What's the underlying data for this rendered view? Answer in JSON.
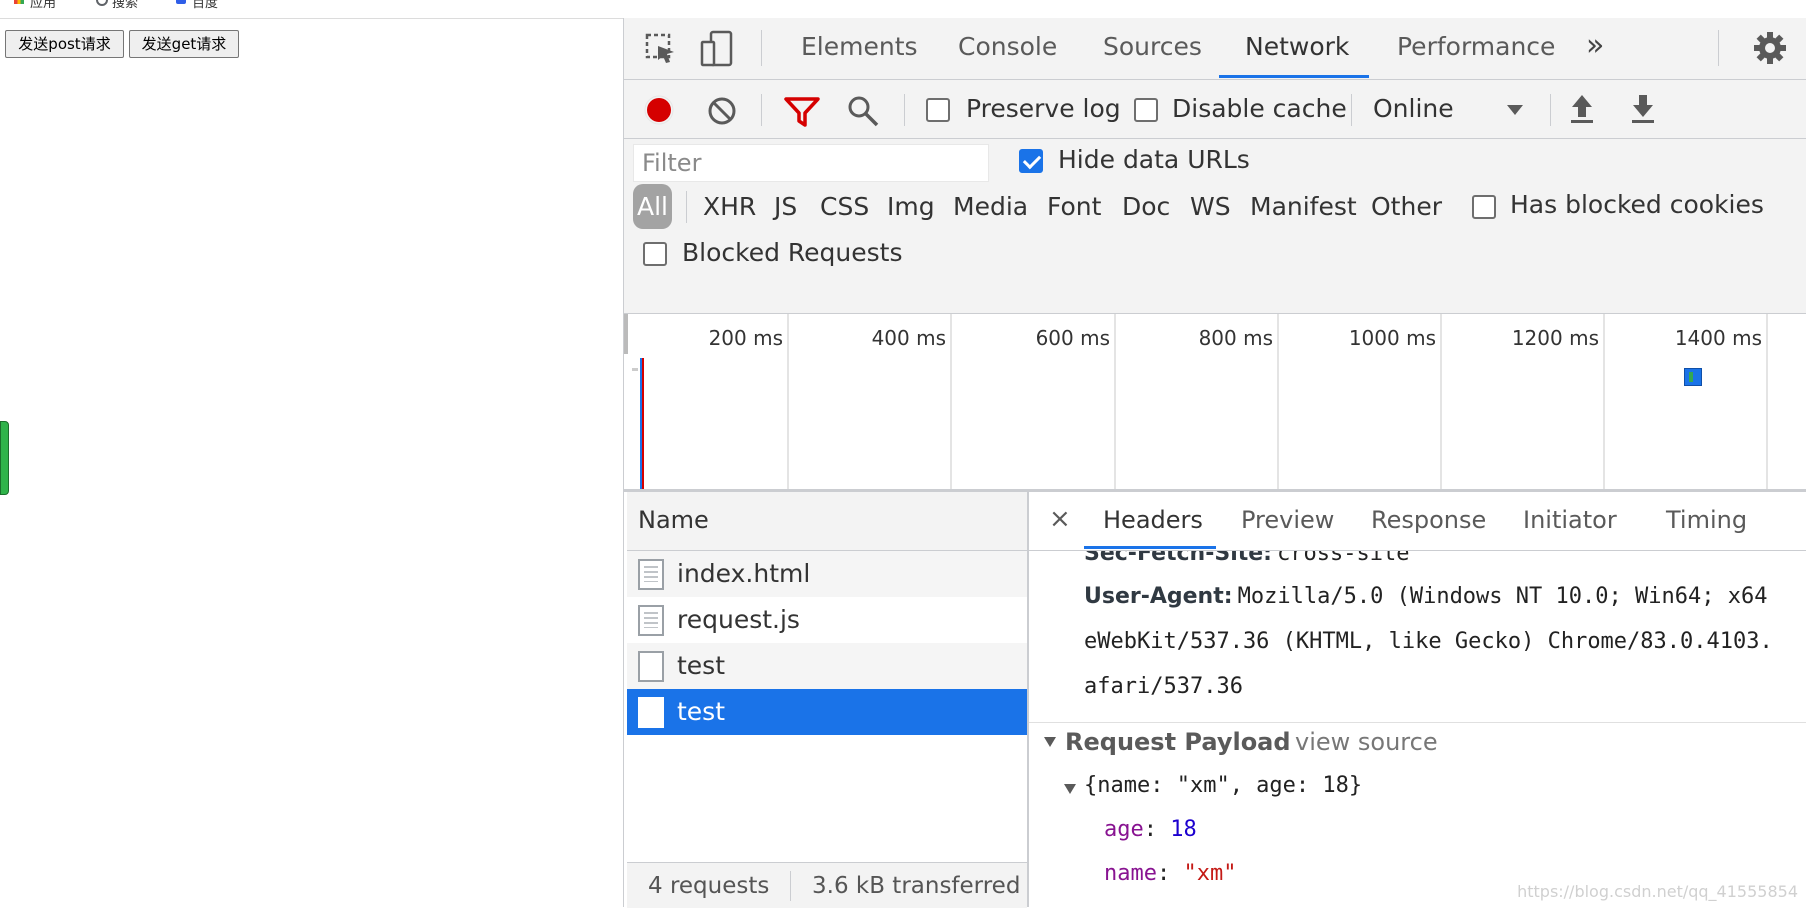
{
  "page": {
    "bookmarks": [
      "应用",
      "搜索",
      "百度"
    ],
    "buttons": {
      "post": "发送post请求",
      "get": "发送get请求"
    }
  },
  "devtools": {
    "tabs": [
      "Elements",
      "Console",
      "Sources",
      "Network",
      "Performance"
    ],
    "active_tab": "Network",
    "more_tabs": "»",
    "toolbar": {
      "preserve_log": {
        "label": "Preserve log",
        "checked": false
      },
      "disable_cache": {
        "label": "Disable cache",
        "checked": false
      },
      "throttling": "Online"
    },
    "filter": {
      "placeholder": "Filter",
      "hide_data_urls": {
        "label": "Hide data URLs",
        "checked": true
      },
      "types": [
        "All",
        "XHR",
        "JS",
        "CSS",
        "Img",
        "Media",
        "Font",
        "Doc",
        "WS",
        "Manifest",
        "Other"
      ],
      "active_type": "All",
      "has_blocked_cookies": {
        "label": "Has blocked cookies",
        "checked": false
      },
      "blocked_requests": {
        "label": "Blocked Requests",
        "checked": false
      }
    },
    "overview": {
      "ticks": [
        "200 ms",
        "400 ms",
        "600 ms",
        "800 ms",
        "1000 ms",
        "1200 ms",
        "1400 ms"
      ]
    },
    "requests": {
      "column_name": "Name",
      "rows": [
        {
          "name": "index.html",
          "selected": false
        },
        {
          "name": "request.js",
          "selected": false
        },
        {
          "name": "test",
          "selected": false
        },
        {
          "name": "test",
          "selected": true
        }
      ],
      "status": {
        "count": "4 requests",
        "transferred": "3.6 kB transferred"
      }
    },
    "details": {
      "close": "×",
      "tabs": [
        "Headers",
        "Preview",
        "Response",
        "Initiator",
        "Timing"
      ],
      "active_tab": "Headers",
      "headers": {
        "sec_fetch_site": {
          "key": "Sec-Fetch-Site:",
          "value": "cross-site"
        },
        "user_agent": {
          "key": "User-Agent:",
          "line1": "Mozilla/5.0 (Windows NT 10.0; Win64; x64",
          "line2": "eWebKit/537.36 (KHTML, like Gecko) Chrome/83.0.4103.",
          "line3": "afari/537.36"
        }
      },
      "payload": {
        "title": "Request Payload",
        "view_source": "view source",
        "summary": "{name: \"xm\", age: 18}",
        "fields": [
          {
            "key": "age",
            "value": "18",
            "type": "number"
          },
          {
            "key": "name",
            "value": "\"xm\"",
            "type": "string"
          }
        ]
      }
    }
  },
  "watermark": "https://blog.csdn.net/qq_41555854",
  "colors": {
    "accent": "#1a73e8",
    "record": "#d50000",
    "filter": "#d50000",
    "key_purple": "#881391",
    "num_blue": "#1c00cf",
    "str_red": "#c41a16"
  }
}
